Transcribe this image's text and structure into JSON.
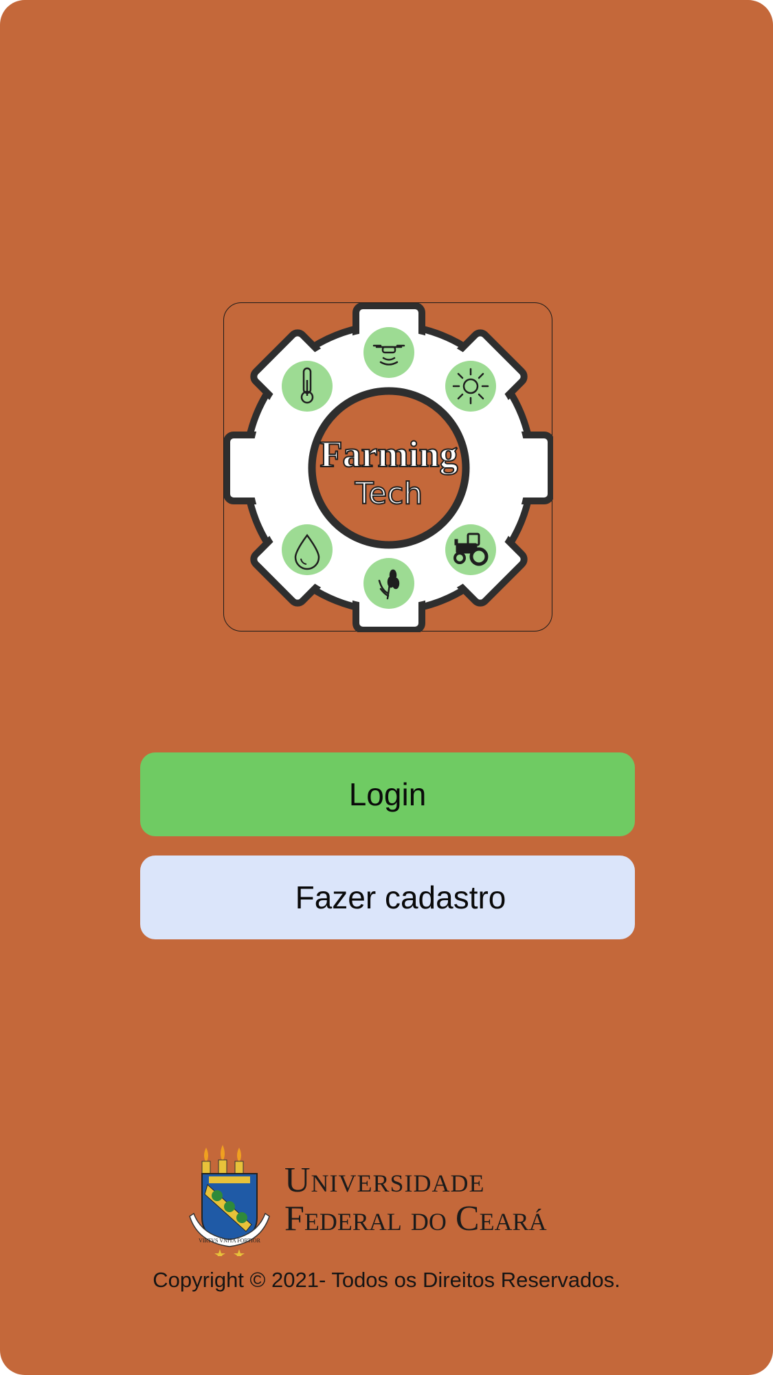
{
  "app": {
    "brand_line1": "Farming",
    "brand_line2": "Tech"
  },
  "logo_icons": [
    "drone-icon",
    "thermometer-icon",
    "sun-icon",
    "water-drop-icon",
    "wheat-icon",
    "tractor-icon"
  ],
  "colors": {
    "background": "#c4683a",
    "login_button": "#6fcb63",
    "register_button": "#dbe5fa",
    "icon_circle": "#9ddb93",
    "gear_outline": "#2e2e2e"
  },
  "actions": {
    "login_label": "Login",
    "register_label": "Fazer cadastro"
  },
  "footer": {
    "university_line1": "Universidade",
    "university_line2": "Federal do Ceará",
    "motto": "VIRTVS VNITA FORTIOR",
    "copyright": "Copyright © 2021- Todos os Direitos Reservados."
  }
}
